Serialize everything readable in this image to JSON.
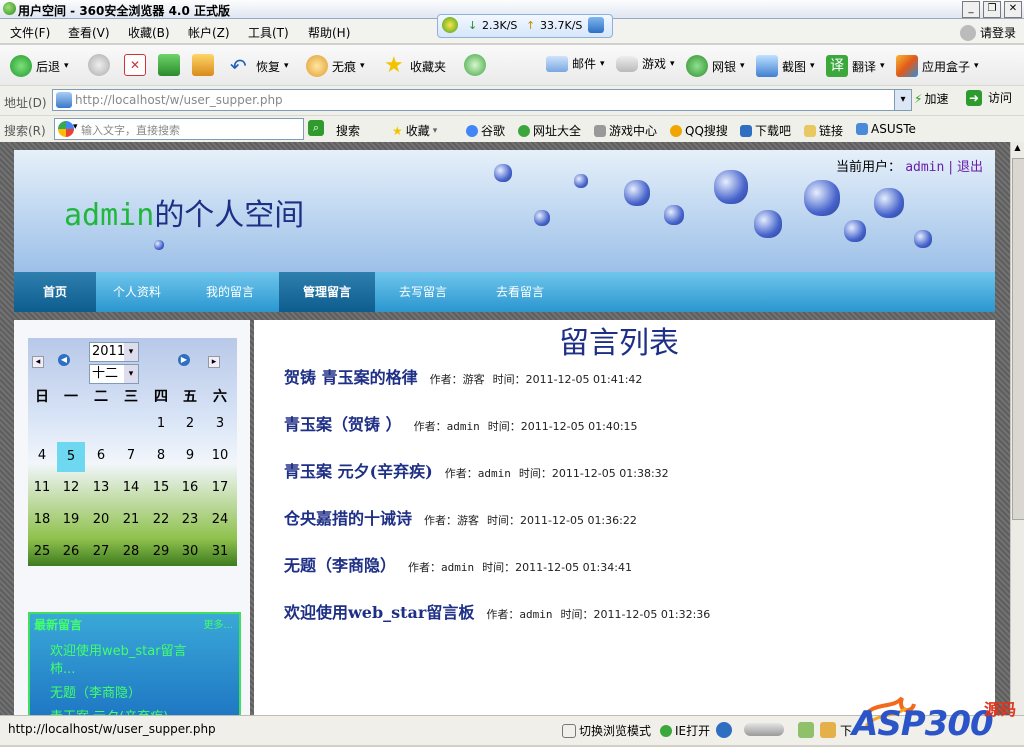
{
  "window": {
    "title": "用户空间 - 360安全浏览器 4.0 正式版",
    "controls": [
      "_",
      "❐",
      "✕"
    ]
  },
  "speed": {
    "down": "2.3K/S",
    "up": "33.7K/S"
  },
  "menubar": {
    "items": [
      "文件(F)",
      "查看(V)",
      "收藏(B)",
      "帐户(Z)",
      "工具(T)",
      "帮助(H)"
    ],
    "login": "请登录"
  },
  "toolbar": {
    "items": [
      "后退",
      "恢复",
      "无痕",
      "收藏夹",
      "邮件",
      "游戏",
      "网银",
      "截图",
      "翻译",
      "应用盒子"
    ]
  },
  "addressbar": {
    "label": "地址(D)",
    "url": "http://localhost/w/user_supper.php",
    "speed_label": "加速",
    "go_label": "访问"
  },
  "searchbar": {
    "label": "搜索(R)",
    "placeholder": "输入文字，直接搜索",
    "button": "搜索",
    "collect": "收藏",
    "favorites": [
      "谷歌",
      "网址大全",
      "游戏中心",
      "QQ搜搜",
      "下载吧",
      "链接",
      "ASUSTe"
    ]
  },
  "page": {
    "current_user_label": "当前用户：",
    "username": "admin",
    "logout": "退出",
    "space_user": "admin",
    "space_suffix": "的个人空间",
    "nav": [
      "首页",
      "个人资料",
      "我的留言",
      "管理留言",
      "去写留言",
      "去看留言"
    ],
    "calendar": {
      "year": "2011",
      "month": "十二",
      "weekdays": [
        "日",
        "一",
        "二",
        "三",
        "四",
        "五",
        "六"
      ],
      "days": [
        [
          "",
          "",
          "",
          "",
          "1",
          "2",
          "3"
        ],
        [
          "4",
          "5",
          "6",
          "7",
          "8",
          "9",
          "10"
        ],
        [
          "11",
          "12",
          "13",
          "14",
          "15",
          "16",
          "17"
        ],
        [
          "18",
          "19",
          "20",
          "21",
          "22",
          "23",
          "24"
        ],
        [
          "25",
          "26",
          "27",
          "28",
          "29",
          "30",
          "31"
        ]
      ],
      "today": "5"
    },
    "latest": {
      "title": "最新留言",
      "more": "更多...",
      "items": [
        "欢迎使用web_star留言",
        "柿...",
        "无题（李商隐）",
        "青玉案 元夕(辛弃疾)"
      ]
    },
    "list_title": "留言列表",
    "messages": [
      {
        "title": "贺铸 青玉案的格律",
        "author_label": "作者：",
        "author": "游客",
        "time_label": "时间：",
        "time": "2011-12-05 01:41:42"
      },
      {
        "title": "青玉案（贺铸 ）",
        "author_label": "作者：",
        "author": "admin",
        "time_label": "时间：",
        "time": "2011-12-05 01:40:15"
      },
      {
        "title": "青玉案 元夕(辛弃疾)",
        "author_label": "作者：",
        "author": "admin",
        "time_label": "时间：",
        "time": "2011-12-05 01:38:32"
      },
      {
        "title": "仓央嘉措的十诫诗",
        "author_label": "作者：",
        "author": "游客",
        "time_label": "时间：",
        "time": "2011-12-05 01:36:22"
      },
      {
        "title": "无题（李商隐）",
        "author_label": "作者：",
        "author": "admin",
        "time_label": "时间：",
        "time": "2011-12-05 01:34:41"
      },
      {
        "title": "欢迎使用web_star留言板",
        "author_label": "作者：",
        "author": "admin",
        "time_label": "时间：",
        "time": "2011-12-05 01:32:36"
      }
    ]
  },
  "statusbar": {
    "url": "http://localhost/w/user_supper.php",
    "mode": "切换浏览模式",
    "ie": "IE打开",
    "download": "下"
  },
  "watermark": {
    "text": "ASP300",
    "suffix": "源码"
  },
  "colors": {
    "accent_green": "#1fb83c",
    "title_blue": "#1e2f86",
    "nav_blue": "#2a96cf",
    "user_purple": "#6a1ea8"
  }
}
